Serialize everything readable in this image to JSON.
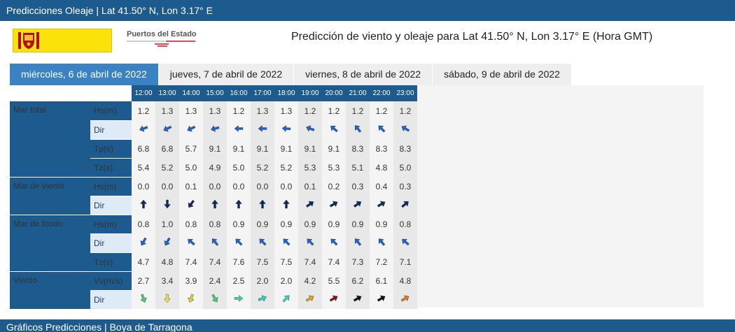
{
  "top_bar": {
    "title": "Predicciones Oleaje | Lat 41.50° N, Lon 3.17° E"
  },
  "logos": {
    "puertos_del_estado": "Puertos del Estado"
  },
  "page_title": "Predicción de viento y oleaje para Lat 41.50° N, Lon 3.17° E (Hora GMT)",
  "tabs": [
    {
      "label": "miércoles, 6 de abril de 2022"
    },
    {
      "label": "jueves, 7 de abril de 2022"
    },
    {
      "label": "viernes, 8 de abril de 2022"
    },
    {
      "label": "sábado, 9 de abril de 2022"
    }
  ],
  "hours": [
    "12:00",
    "13:00",
    "14:00",
    "15:00",
    "16:00",
    "17:00",
    "18:00",
    "19:00",
    "20:00",
    "21:00",
    "22:00",
    "23:00"
  ],
  "sections": [
    {
      "name": "Mar total",
      "rows": [
        {
          "label": "Hs(m)",
          "type": "num",
          "values": [
            "1.2",
            "1.3",
            "1.3",
            "1.3",
            "1.2",
            "1.3",
            "1.3",
            "1.2",
            "1.2",
            "1.2",
            "1.2",
            "1.2"
          ]
        },
        {
          "label": "Dir",
          "type": "dir",
          "color": "#1f63d0",
          "angles": [
            250,
            245,
            245,
            255,
            270,
            270,
            275,
            290,
            310,
            320,
            315,
            300
          ]
        },
        {
          "label": "Tp(s)",
          "type": "num",
          "values": [
            "6.8",
            "6.8",
            "5.7",
            "9.1",
            "9.1",
            "9.1",
            "9.1",
            "9.1",
            "9.1",
            "8.3",
            "8.3",
            "8.3"
          ]
        },
        {
          "label": "Tz(s)",
          "type": "num",
          "values": [
            "5.4",
            "5.2",
            "5.0",
            "4.9",
            "5.0",
            "5.2",
            "5.2",
            "5.3",
            "5.3",
            "5.1",
            "4.8",
            "5.0"
          ]
        }
      ]
    },
    {
      "name": "Mar de viento",
      "rows": [
        {
          "label": "Hs(m)",
          "type": "num",
          "values": [
            "0.0",
            "0.0",
            "0.1",
            "0.0",
            "0.0",
            "0.0",
            "0.0",
            "0.1",
            "0.2",
            "0.3",
            "0.4",
            "0.3"
          ]
        },
        {
          "label": "Dir",
          "type": "dir",
          "color": "#0d2a5e",
          "angles": [
            0,
            180,
            215,
            0,
            0,
            0,
            0,
            55,
            60,
            55,
            60,
            50
          ]
        }
      ]
    },
    {
      "name": "Mar de fondo",
      "rows": [
        {
          "label": "Hs(m)",
          "type": "num",
          "values": [
            "0.8",
            "1.0",
            "0.8",
            "0.8",
            "0.9",
            "0.9",
            "0.9",
            "0.9",
            "0.9",
            "0.9",
            "0.9",
            "0.8"
          ]
        },
        {
          "label": "Dir",
          "type": "dir",
          "color": "#1f63d0",
          "angles": [
            210,
            210,
            310,
            320,
            315,
            315,
            315,
            315,
            315,
            320,
            320,
            310
          ]
        },
        {
          "label": "Tz(s)",
          "type": "num",
          "values": [
            "4.7",
            "4.8",
            "7.4",
            "7.4",
            "7.6",
            "7.5",
            "7.5",
            "7.4",
            "7.4",
            "7.3",
            "7.2",
            "7.1"
          ]
        }
      ]
    },
    {
      "name": "Viento",
      "rows": [
        {
          "label": "Vv(m/s)",
          "type": "num",
          "values": [
            "2.7",
            "3.4",
            "3.9",
            "2.4",
            "2.5",
            "2.0",
            "2.0",
            "4.2",
            "5.5",
            "6.2",
            "6.1",
            "4.8"
          ]
        },
        {
          "label": "Dir",
          "type": "dir",
          "colors": [
            "#3fd47a",
            "#e8e83a",
            "#e8d22a",
            "#3fd47a",
            "#3fd4a0",
            "#33d0c8",
            "#3ed0c0",
            "#e8a020",
            "#8b1010",
            "#111111",
            "#111111",
            "#e87820"
          ],
          "angles": [
            160,
            180,
            200,
            150,
            90,
            70,
            45,
            60,
            60,
            60,
            60,
            60
          ]
        }
      ]
    }
  ],
  "bottom_bar": {
    "title": "Gráficos Predicciones | Boya de Tarragona"
  }
}
